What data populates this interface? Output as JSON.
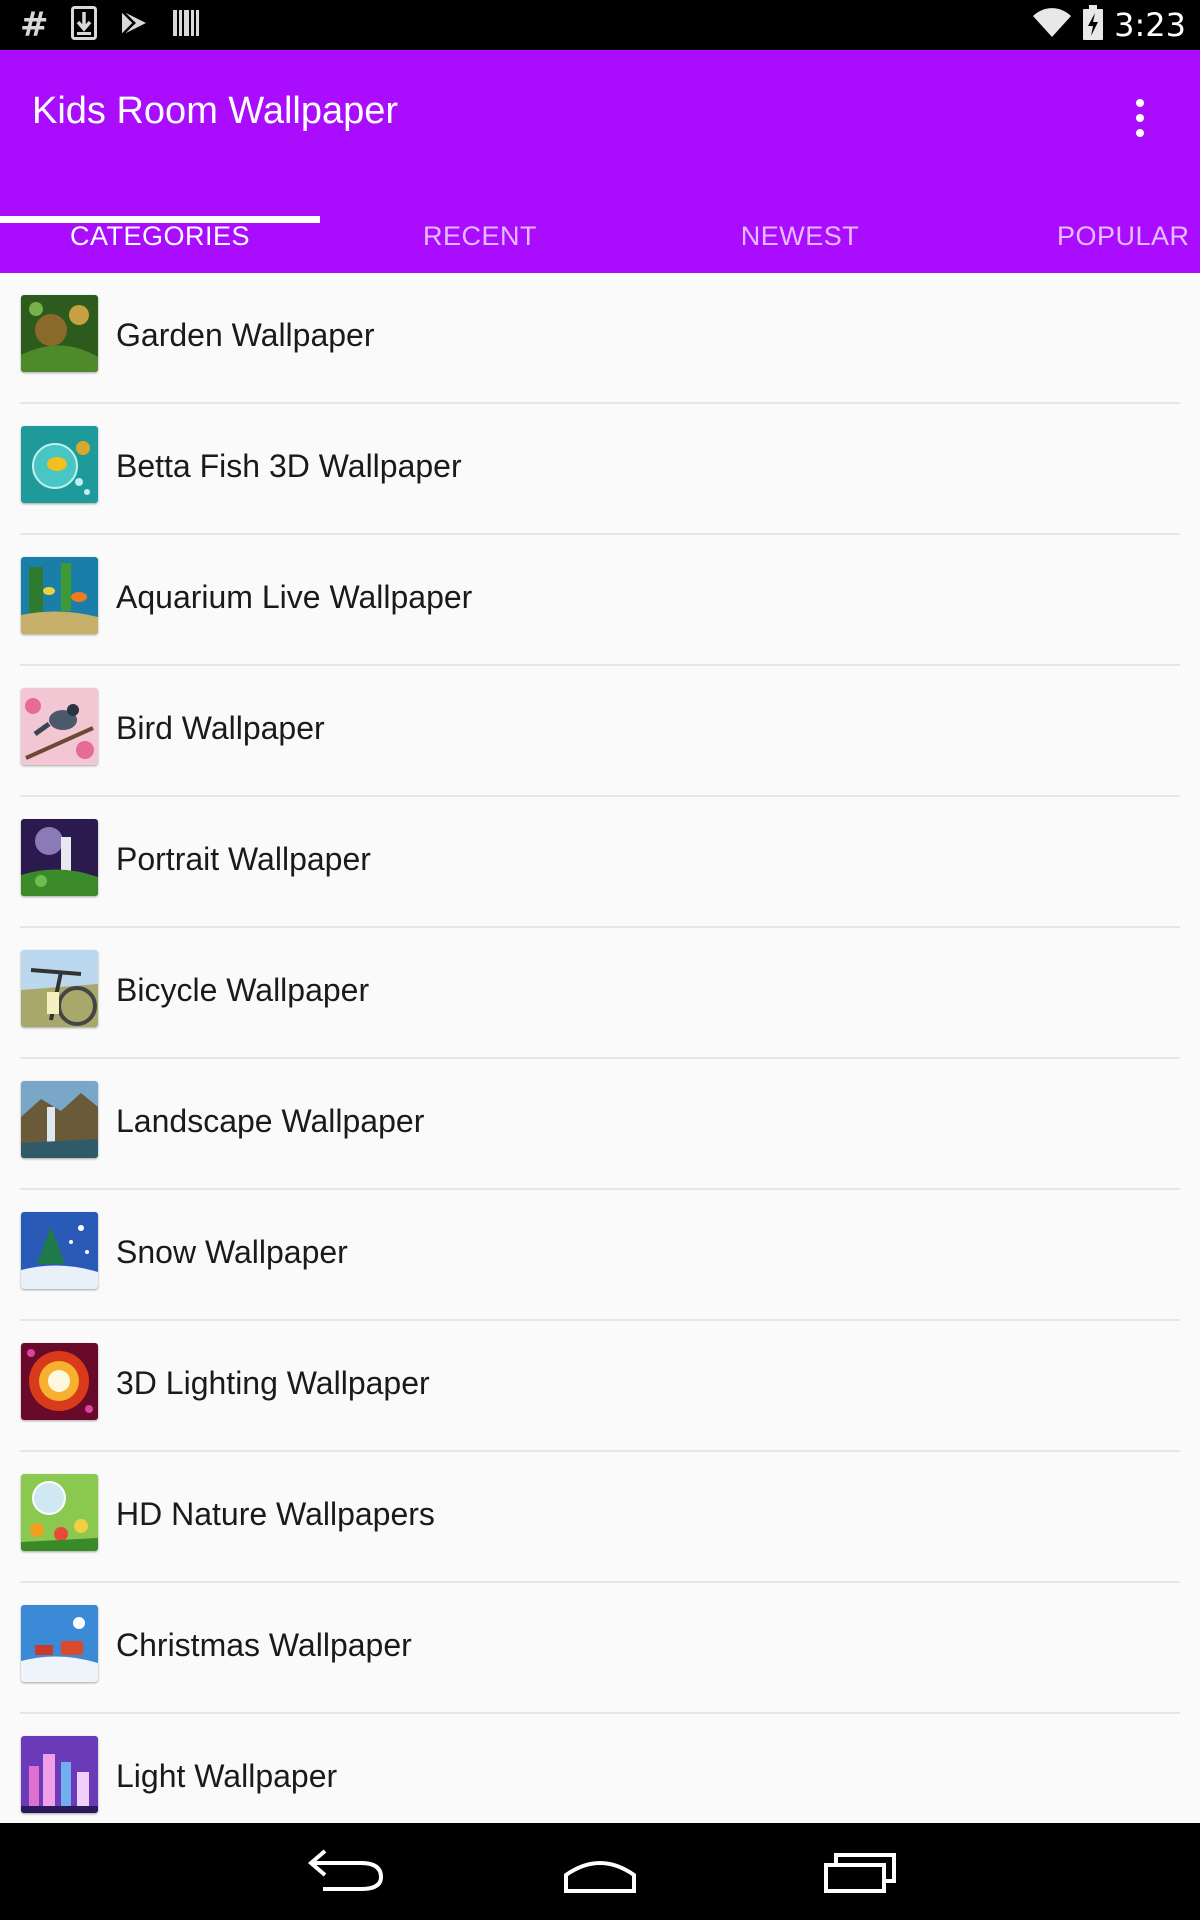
{
  "status_bar": {
    "left_icons": [
      "hash-icon",
      "download-icon",
      "play-store-icon",
      "barcode-icon"
    ],
    "hash_glyph": "#",
    "time": "3:23",
    "right_icons": [
      "wifi-icon",
      "battery-charging-icon"
    ]
  },
  "app_bar": {
    "title": "Kids Room Wallpaper",
    "accent_color": "#aa0dfd",
    "overflow_icon": "more-vert-icon"
  },
  "tabs": [
    {
      "label": "CATEGORIES",
      "active": true
    },
    {
      "label": "RECENT",
      "active": false
    },
    {
      "label": "NEWEST",
      "active": false
    },
    {
      "label": "POPULAR",
      "active": false
    }
  ],
  "categories": [
    {
      "label": "Garden Wallpaper"
    },
    {
      "label": "Betta Fish 3D Wallpaper"
    },
    {
      "label": "Aquarium Live Wallpaper"
    },
    {
      "label": "Bird Wallpaper"
    },
    {
      "label": "Portrait Wallpaper"
    },
    {
      "label": "Bicycle Wallpaper"
    },
    {
      "label": "Landscape Wallpaper"
    },
    {
      "label": "Snow Wallpaper"
    },
    {
      "label": "3D Lighting Wallpaper"
    },
    {
      "label": "HD Nature Wallpapers"
    },
    {
      "label": "Christmas Wallpaper"
    },
    {
      "label": "Light Wallpaper"
    }
  ],
  "nav_bar": {
    "icons": [
      "back-icon",
      "home-icon",
      "recents-icon"
    ]
  }
}
